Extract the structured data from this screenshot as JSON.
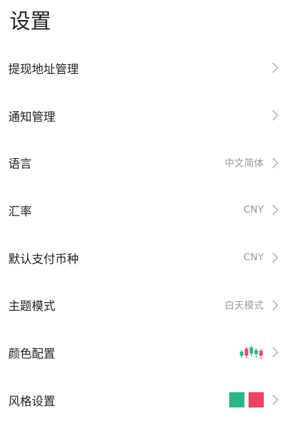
{
  "header": {
    "title": "设置"
  },
  "colors": {
    "up": "#2bb682",
    "down": "#f0415f",
    "chevron": "#b5b5b5",
    "value": "#9a9a9a"
  },
  "settings": {
    "items": [
      {
        "label": "提现地址管理",
        "value": "",
        "icon": "chevron-right-icon"
      },
      {
        "label": "通知管理",
        "value": "",
        "icon": "chevron-right-icon"
      },
      {
        "label": "语言",
        "value": "中文简体",
        "icon": "chevron-right-icon"
      },
      {
        "label": "汇率",
        "value": "CNY",
        "icon": "chevron-right-icon"
      },
      {
        "label": "默认支付币种",
        "value": "CNY",
        "icon": "chevron-right-icon"
      },
      {
        "label": "主题模式",
        "value": "白天模式",
        "icon": "chevron-right-icon"
      },
      {
        "label": "颜色配置",
        "value": "",
        "icon": "candlestick-icon"
      },
      {
        "label": "风格设置",
        "value": "",
        "icon": "color-swatch-icon"
      }
    ]
  }
}
